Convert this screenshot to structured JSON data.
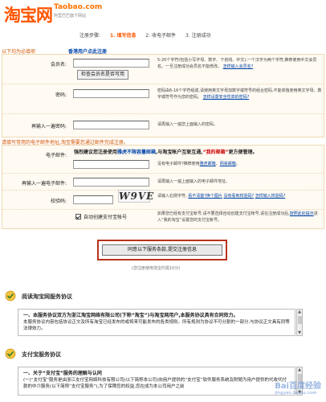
{
  "header": {
    "logo": "淘宝网",
    "domain": "Taobao.com",
    "slogan": "阿里巴巴旗下网站"
  },
  "steps": {
    "prefix": "注册步骤:",
    "step1": "1. 填写信息",
    "step2": "2. 收电子邮件",
    "step3": "3. 注册成功"
  },
  "section_required": "以下均为必填项",
  "sub_link": "香港用户点此注册",
  "form": {
    "member": {
      "label": "会员名:",
      "value": "",
      "check_button": "检查会员名是否可用",
      "hint": "5-20个字符(包括小写字母、数字、下划线、中文),一个汉字为两个字符,推荐使用中文会员名。一旦注册成功会员名不能修改。",
      "hint_link": "怎样输入会员名?"
    },
    "password": {
      "label": "密码:",
      "value": "",
      "hint": "密码由6-16个字符组成,请使用英文字母加数字或符号的组合密码,不能单独使用英文字母、数字或符号作为您的密码。",
      "hint_link": "怎样设置安全性高的密码?"
    },
    "password_confirm": {
      "label": "再输入一遍密码:",
      "value": "",
      "hint": "请再输入一遍您上面输入的密码。"
    }
  },
  "email_section": "请填写常用的电子邮件地址,淘宝需要您通过邮件完成注册。",
  "email": {
    "note_prefix": "强烈建议您注册使用",
    "note_blue": "雅虎不限容量邮箱",
    "note_mid": ",与淘宝帐户互联互通,",
    "note_red": "“我的邮箱”",
    "note_suffix": "更方便管理。",
    "label": "电子邮件:",
    "value": "",
    "hint_prefix": "没有电子邮件?推荐使用",
    "hint_link1": "雅虎邮箱",
    "hint_sep": "、",
    "hint_link2": "网易邮箱",
    "hint_end": "。"
  },
  "email_confirm": {
    "label": "再输入一遍电子邮件:",
    "value": "",
    "hint": "请再输入一遍上面输入的电子邮件地址。"
  },
  "captcha": {
    "label": "校验码:",
    "value": "",
    "image_text": "W9VE",
    "hint_prefix": "请输入右侧字符,",
    "hint_link1": "看不清楚?换个图片",
    "hint_link2": "没有看到校验码?",
    "hint_link3": "怎样输入校验码?"
  },
  "alipay": {
    "checkbox_label": "自动创建支付宝帐号",
    "hint_prefix": "如果您已经有支付宝帐号,请不要选择自动创建支付宝帐号,请在注册成功后,",
    "hint_link": "按照此处提示",
    "hint_suffix": "进入“我的淘宝”设置您的支付宝帐号。"
  },
  "submit": {
    "label": "同意以下服务条款,提交注册信息",
    "note": "(您注册使用淘宝约需10分)"
  },
  "agreements": [
    {
      "title": "阅读淘宝网服务协议",
      "line1": "一、本服务协议双方为浙江淘宝网络有限公司(下称“淘宝”)与淘宝网用户,本服务协议具有合同效力。",
      "line2": "本服务协议内容包括协议正文及所有淘宝已经发布的或将来可能发布的各类规则。所有规则为协议不可分割的一部分,与协议正文具有同等法律效力。"
    },
    {
      "title": "支付宝服务协议",
      "line1": "一、关于“支付宝”服务的理解与认同",
      "line2": "(一)“支付宝”服务是由浙江支付宝网络科技有限公司(以下简称本公司)向用户提供的“支付宝”软件服务系统及附随为用户提供的代收代付款的中介服务(以下简称“支付宝服务”),为了保障您的权益,您在成为本公司用户之前"
    }
  ],
  "watermark": {
    "main": "Bai百度经验",
    "sub": "jingyan.baidu.com"
  }
}
